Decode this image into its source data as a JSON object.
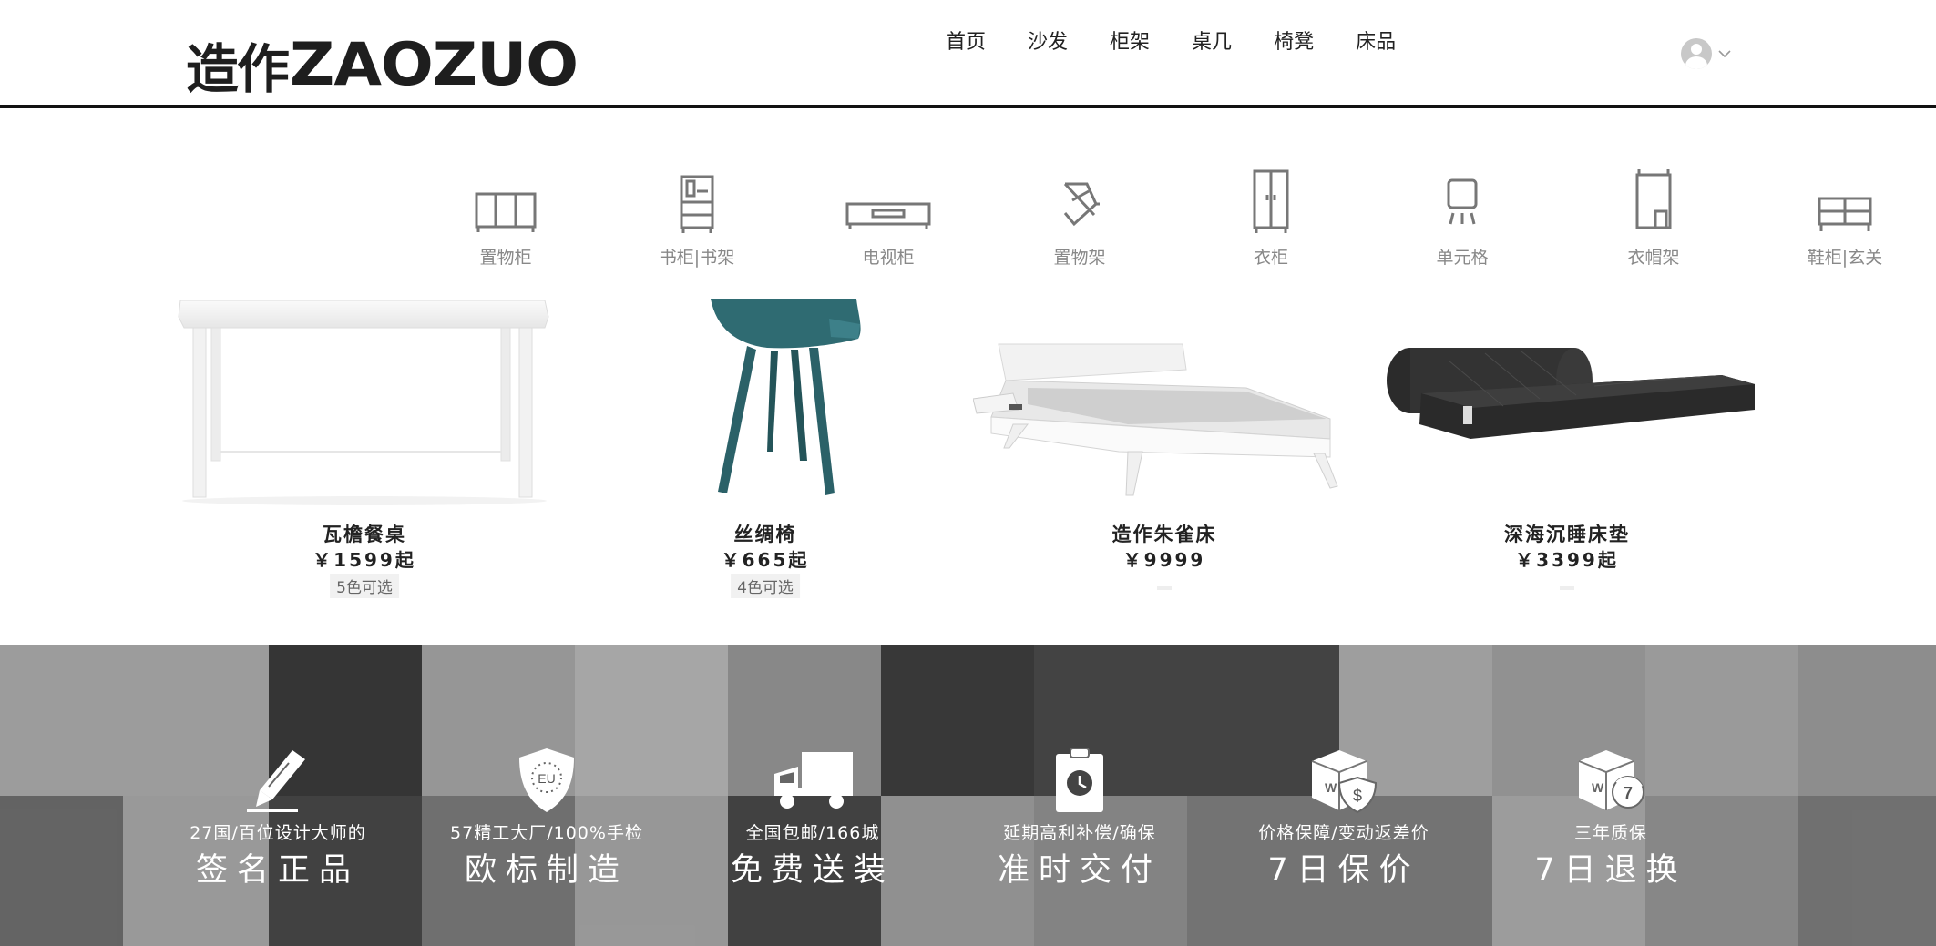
{
  "header": {
    "logo_cn": "造作",
    "logo_en": "ZAOZUO",
    "nav": [
      {
        "label": "首页"
      },
      {
        "label": "沙发"
      },
      {
        "label": "柜架"
      },
      {
        "label": "桌几"
      },
      {
        "label": "椅凳"
      },
      {
        "label": "床品"
      }
    ]
  },
  "categories": [
    {
      "label": "置物柜",
      "icon": "storage-cabinet-icon"
    },
    {
      "label": "书柜|书架",
      "icon": "bookcase-icon"
    },
    {
      "label": "电视柜",
      "icon": "tv-stand-icon"
    },
    {
      "label": "置物架",
      "icon": "shelf-rack-icon"
    },
    {
      "label": "衣柜",
      "icon": "wardrobe-icon"
    },
    {
      "label": "单元格",
      "icon": "unit-cell-icon"
    },
    {
      "label": "衣帽架",
      "icon": "coat-rack-icon"
    },
    {
      "label": "鞋柜|玄关",
      "icon": "shoe-cabinet-icon"
    }
  ],
  "products": [
    {
      "name": "瓦檐餐桌",
      "price": "￥1599起",
      "colors": "5色可选"
    },
    {
      "name": "丝绸椅",
      "price": "￥665起",
      "colors": "4色可选"
    },
    {
      "name": "造作朱雀床",
      "price": "￥9999"
    },
    {
      "name": "深海沉睡床垫",
      "price": "￥3399起"
    }
  ],
  "features": [
    {
      "sub": "27国/百位设计大师的",
      "main": "签名正品",
      "icon": "pen-signature-icon"
    },
    {
      "sub": "57精工大厂/100%手检",
      "main": "欧标制造",
      "icon": "eu-shield-icon"
    },
    {
      "sub": "全国包邮/166城",
      "main": "免费送装",
      "icon": "delivery-truck-icon"
    },
    {
      "sub": "延期高利补偿/确保",
      "main": "准时交付",
      "icon": "clock-clipboard-icon"
    },
    {
      "sub": "价格保障/变动返差价",
      "main": "7日保价",
      "icon": "price-box-icon"
    },
    {
      "sub": "三年质保",
      "main": "7日退换",
      "icon": "return-box-icon"
    }
  ],
  "colors": {
    "header_rule": "#111111",
    "banner_bg": "#5a5a5a",
    "icon_gray": "#777777"
  }
}
